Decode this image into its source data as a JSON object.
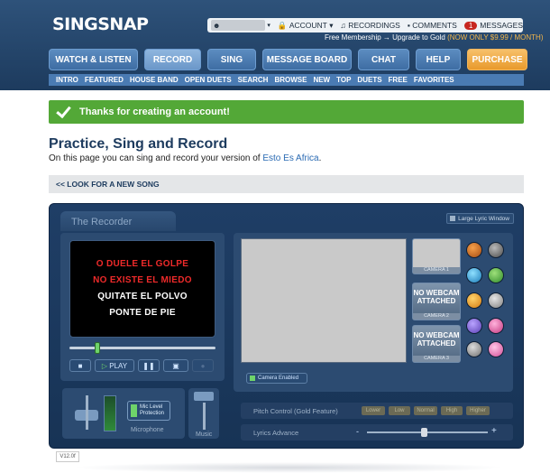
{
  "brand": {
    "name": "SINGSNAP"
  },
  "topbar": {
    "account": "ACCOUNT",
    "recordings": "RECORDINGS",
    "comments": "COMMENTS",
    "messages_count": "1",
    "messages": "MESSAGES"
  },
  "promo": {
    "text": "Free Membership",
    "upgrade": "→ Upgrade to Gold",
    "offer": "(NOW ONLY $9.99 / MONTH)"
  },
  "nav": {
    "items": [
      "WATCH & LISTEN",
      "RECORD",
      "SING",
      "MESSAGE BOARD",
      "CHAT",
      "HELP",
      "PURCHASE"
    ]
  },
  "subnav": {
    "items": [
      "INTRO",
      "FEATURED",
      "HOUSE BAND",
      "OPEN DUETS",
      "SEARCH",
      "BROWSE",
      "NEW",
      "TOP",
      "DUETS",
      "FREE",
      "FAVORITES"
    ]
  },
  "notice": {
    "text": "Thanks for creating an account!"
  },
  "page": {
    "title": "Practice, Sing and Record",
    "intro_prefix": "On this page you can sing and record your version of ",
    "song_link": "Esto Es Africa",
    "intro_suffix": "."
  },
  "back": {
    "label": "<< LOOK FOR A NEW SONG"
  },
  "recorder": {
    "tab": "The Recorder",
    "large_lyric": "Large Lyric Window",
    "lyrics": [
      {
        "text": "O DUELE EL GOLPE",
        "color": "#ee2a2a"
      },
      {
        "text": "NO EXISTE EL MIEDO",
        "color": "#ee2a2a"
      },
      {
        "text": "QUITATE EL POLVO",
        "color": "#ffffff"
      },
      {
        "text": "PONTE DE PIE",
        "color": "#ffffff"
      }
    ],
    "play": "PLAY",
    "camera_enabled": "Camera Enabled",
    "cameras": [
      {
        "label": "CAMERA 1",
        "status": ""
      },
      {
        "label": "CAMERA 2",
        "status": "NO WEBCAM ATTACHED"
      },
      {
        "label": "CAMERA 3",
        "status": "NO WEBCAM ATTACHED"
      }
    ],
    "mic_protect": "Mic Level Protection",
    "microphone": "Microphone",
    "music": "Music",
    "pitch_label": "Pitch Control (Gold Feature)",
    "pitch_buttons": [
      "Lower",
      "Low",
      "Normal",
      "High",
      "Higher"
    ],
    "lyrics_advance": "Lyrics Advance",
    "minus": "-",
    "plus": "+",
    "version": "V12.0f"
  }
}
